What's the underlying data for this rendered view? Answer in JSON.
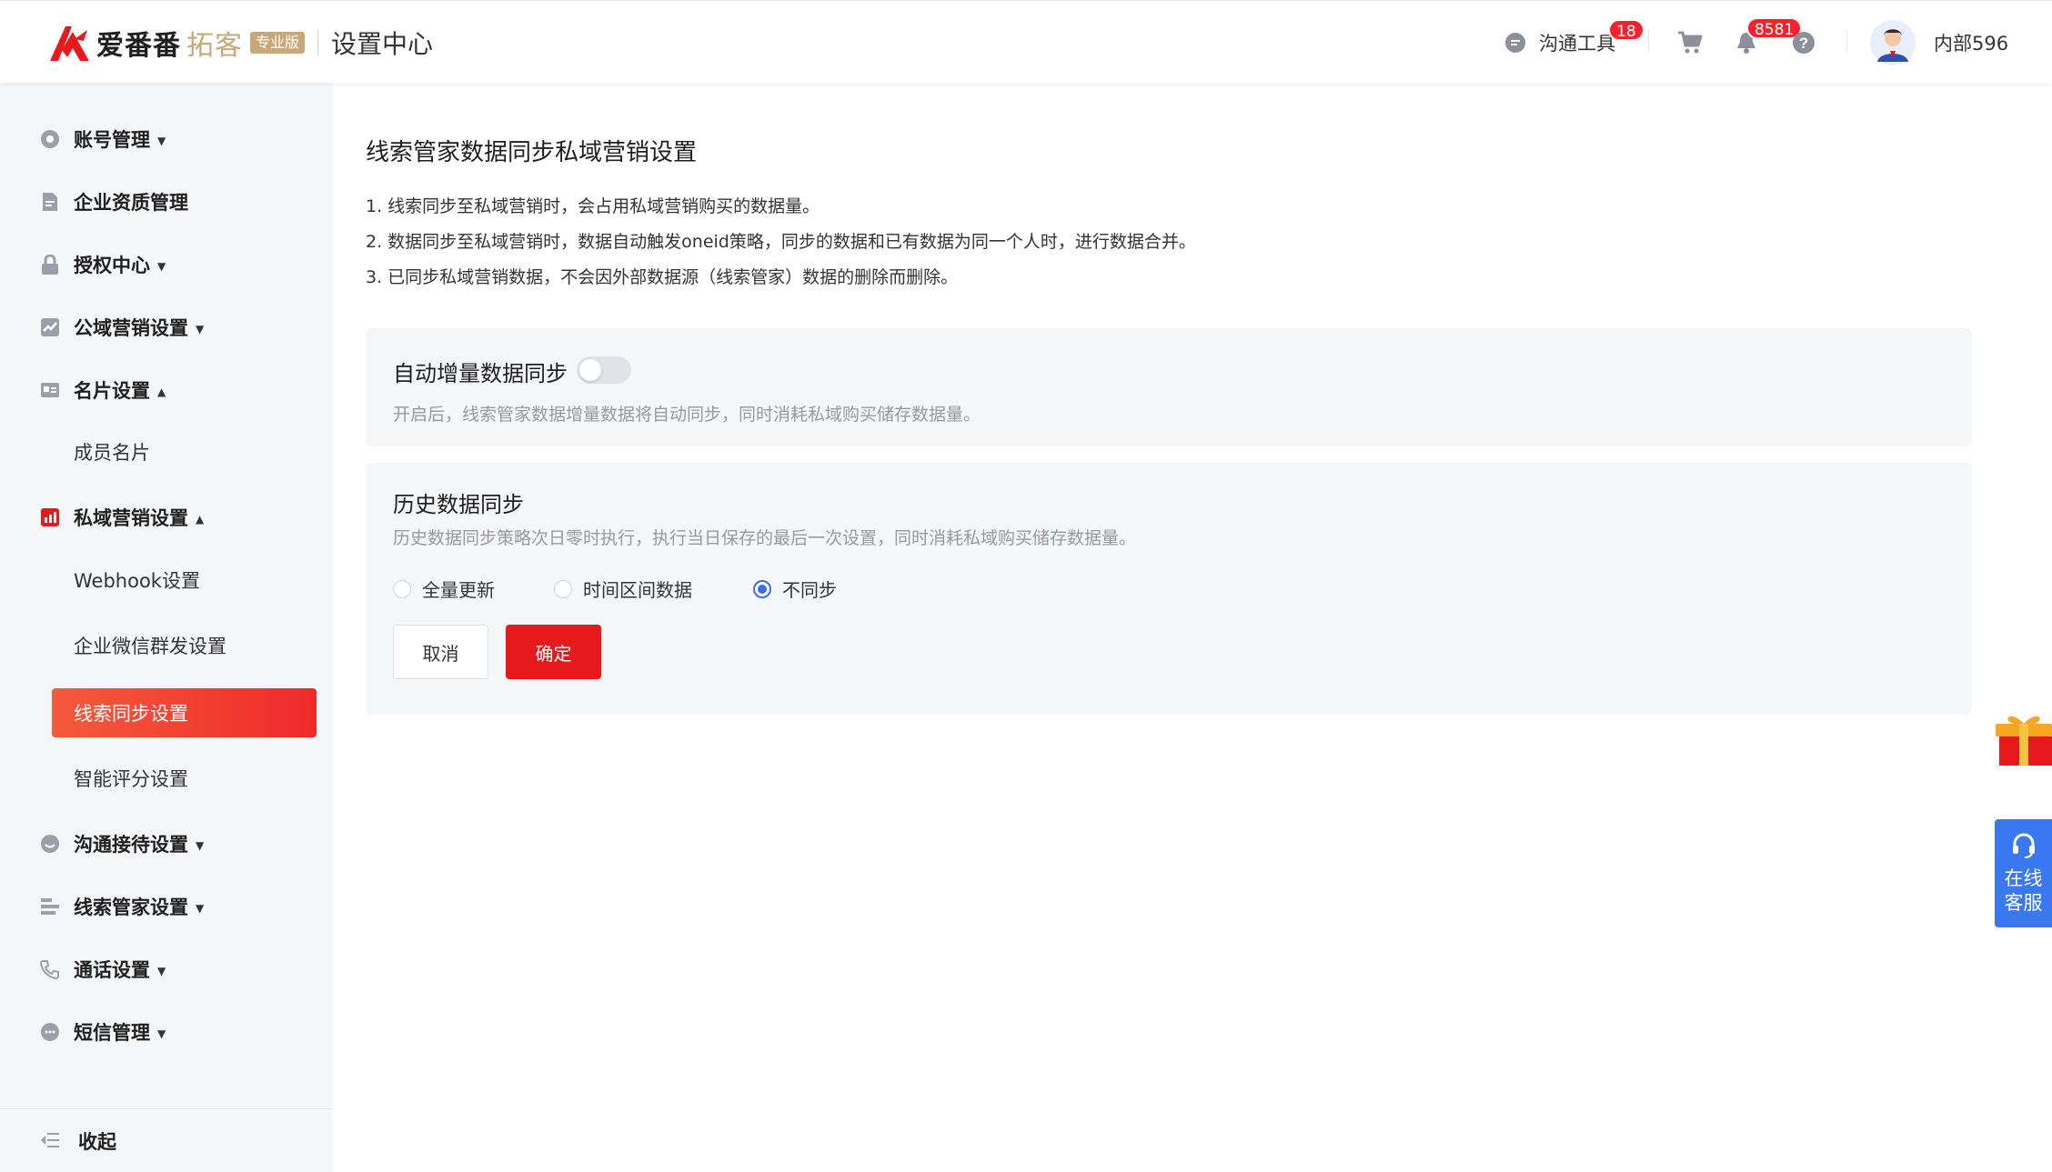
{
  "header": {
    "brand_name": "爱番番",
    "brand_product": "拓客",
    "brand_edition": "专业版",
    "section_title": "设置中心",
    "comm_tool_label": "沟通工具",
    "comm_tool_badge": "18",
    "notify_badge": "8581",
    "user_name": "内部596"
  },
  "sidebar": {
    "account": "账号管理",
    "enterprise": "企业资质管理",
    "auth": "授权中心",
    "public_marketing": "公域营销设置",
    "card_settings": "名片设置",
    "member_card": "成员名片",
    "private_marketing": "私域营销设置",
    "webhook": "Webhook设置",
    "wechat_group": "企业微信群发设置",
    "lead_sync": "线索同步设置",
    "smart_score": "智能评分设置",
    "comm_reception": "沟通接待设置",
    "lead_manager": "线索管家设置",
    "call_settings": "通话设置",
    "sms": "短信管理",
    "collapse": "收起"
  },
  "main": {
    "title": "线索管家数据同步私域营销设置",
    "notes": [
      "1. 线索同步至私域营销时，会占用私域营销购买的数据量。",
      "2. 数据同步至私域营销时，数据自动触发oneid策略，同步的数据和已有数据为同一个人时，进行数据合并。",
      "3. 已同步私域营销数据，不会因外部数据源（线索管家）数据的删除而删除。"
    ],
    "auto_sync": {
      "title": "自动增量数据同步",
      "enabled": false,
      "desc": "开启后，线索管家数据增量数据将自动同步，同时消耗私域购买储存数据量。"
    },
    "history_sync": {
      "title": "历史数据同步",
      "desc": "历史数据同步策略次日零时执行，执行当日保存的最后一次设置，同时消耗私域购买储存数据量。",
      "options": [
        "全量更新",
        "时间区间数据",
        "不同步"
      ],
      "selected": "不同步"
    },
    "cancel_label": "取消",
    "confirm_label": "确定"
  },
  "float": {
    "service_line1": "在线",
    "service_line2": "客服"
  },
  "colors": {
    "accent_red": "#e8191d",
    "radio_blue": "#3b6cf5",
    "service_blue": "#3a78f2",
    "brand_gold": "#c9a777"
  }
}
